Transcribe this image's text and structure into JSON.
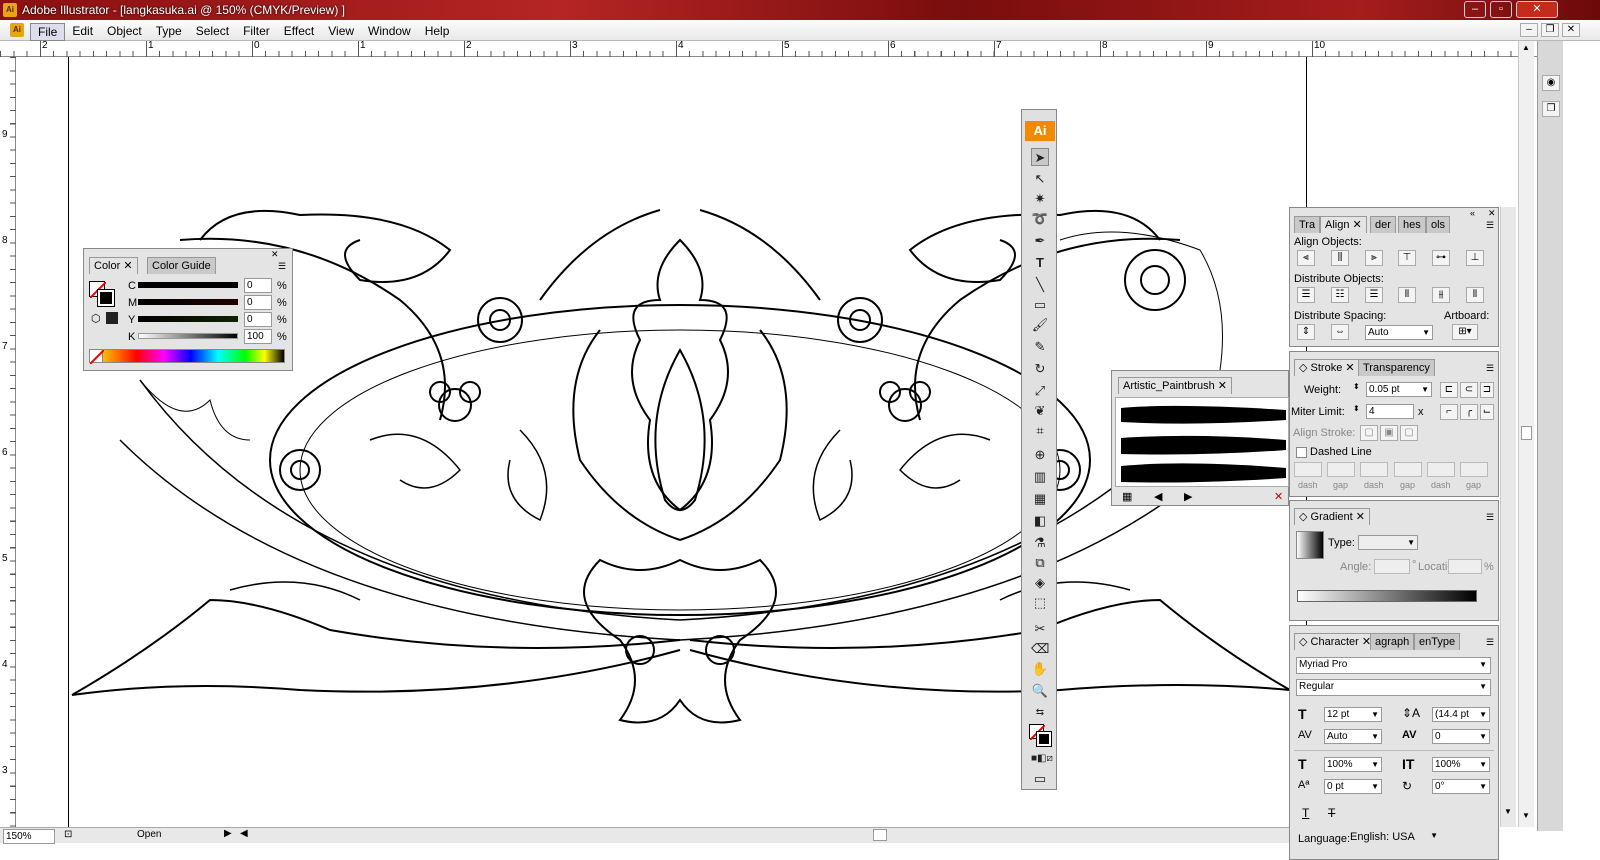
{
  "window": {
    "app_badge": "Ai",
    "title": "Adobe Illustrator - [langkasuka.ai @ 150% (CMYK/Preview) ]"
  },
  "menu": [
    "File",
    "Edit",
    "Object",
    "Type",
    "Select",
    "Filter",
    "Effect",
    "View",
    "Window",
    "Help"
  ],
  "ruler": {
    "h_labels": [
      "2",
      "1",
      "0",
      "1",
      "2",
      "3",
      "4",
      "5",
      "6",
      "7",
      "8",
      "9",
      "10"
    ],
    "v_labels": [
      "9",
      "8",
      "7",
      "6",
      "5",
      "4",
      "3"
    ]
  },
  "status": {
    "zoom": "150%",
    "state": "Open"
  },
  "color_panel": {
    "tabs": [
      "Color",
      "Color Guide"
    ],
    "channels": [
      {
        "label": "C",
        "value": "0",
        "unit": "%"
      },
      {
        "label": "M",
        "value": "0",
        "unit": "%"
      },
      {
        "label": "Y",
        "value": "0",
        "unit": "%"
      },
      {
        "label": "K",
        "value": "100",
        "unit": "%"
      }
    ]
  },
  "brush_panel": {
    "tab": "Artistic_Paintbrush"
  },
  "align_panel": {
    "tabs": [
      "Tra",
      "Align",
      "der",
      "hes",
      "ols"
    ],
    "align_objects": "Align Objects:",
    "distribute_objects": "Distribute Objects:",
    "distribute_spacing": "Distribute Spacing:",
    "artboard": "Artboard:",
    "spacing_value": "Auto"
  },
  "stroke_panel": {
    "tabs": [
      "Stroke",
      "Transparency"
    ],
    "weight_label": "Weight:",
    "weight": "0.05 pt",
    "miter_label": "Miter Limit:",
    "miter": "4",
    "miter_unit": "x",
    "align_label": "Align Stroke:",
    "dashed_label": "Dashed Line",
    "dash_labels": [
      "dash",
      "gap",
      "dash",
      "gap",
      "dash",
      "gap"
    ]
  },
  "gradient_panel": {
    "tab": "Gradient",
    "type_label": "Type:",
    "angle_label": "Angle:",
    "angle_unit": "°",
    "location_label": "Location:",
    "location_unit": "%"
  },
  "character_panel": {
    "tabs": [
      "Character",
      "agraph",
      "enType"
    ],
    "font": "Myriad Pro",
    "style": "Regular",
    "size": "12 pt",
    "leading": "(14.4 pt",
    "kerning": "Auto",
    "tracking": "0",
    "vscale": "100%",
    "hscale": "100%",
    "baseline": "0 pt",
    "rotation": "0°",
    "language_label": "Language:",
    "language": "English: USA"
  },
  "tools_panel": {
    "badge": "Ai"
  },
  "colors": {
    "accent": "#f08a00",
    "titlebar": "#a51d1d"
  }
}
